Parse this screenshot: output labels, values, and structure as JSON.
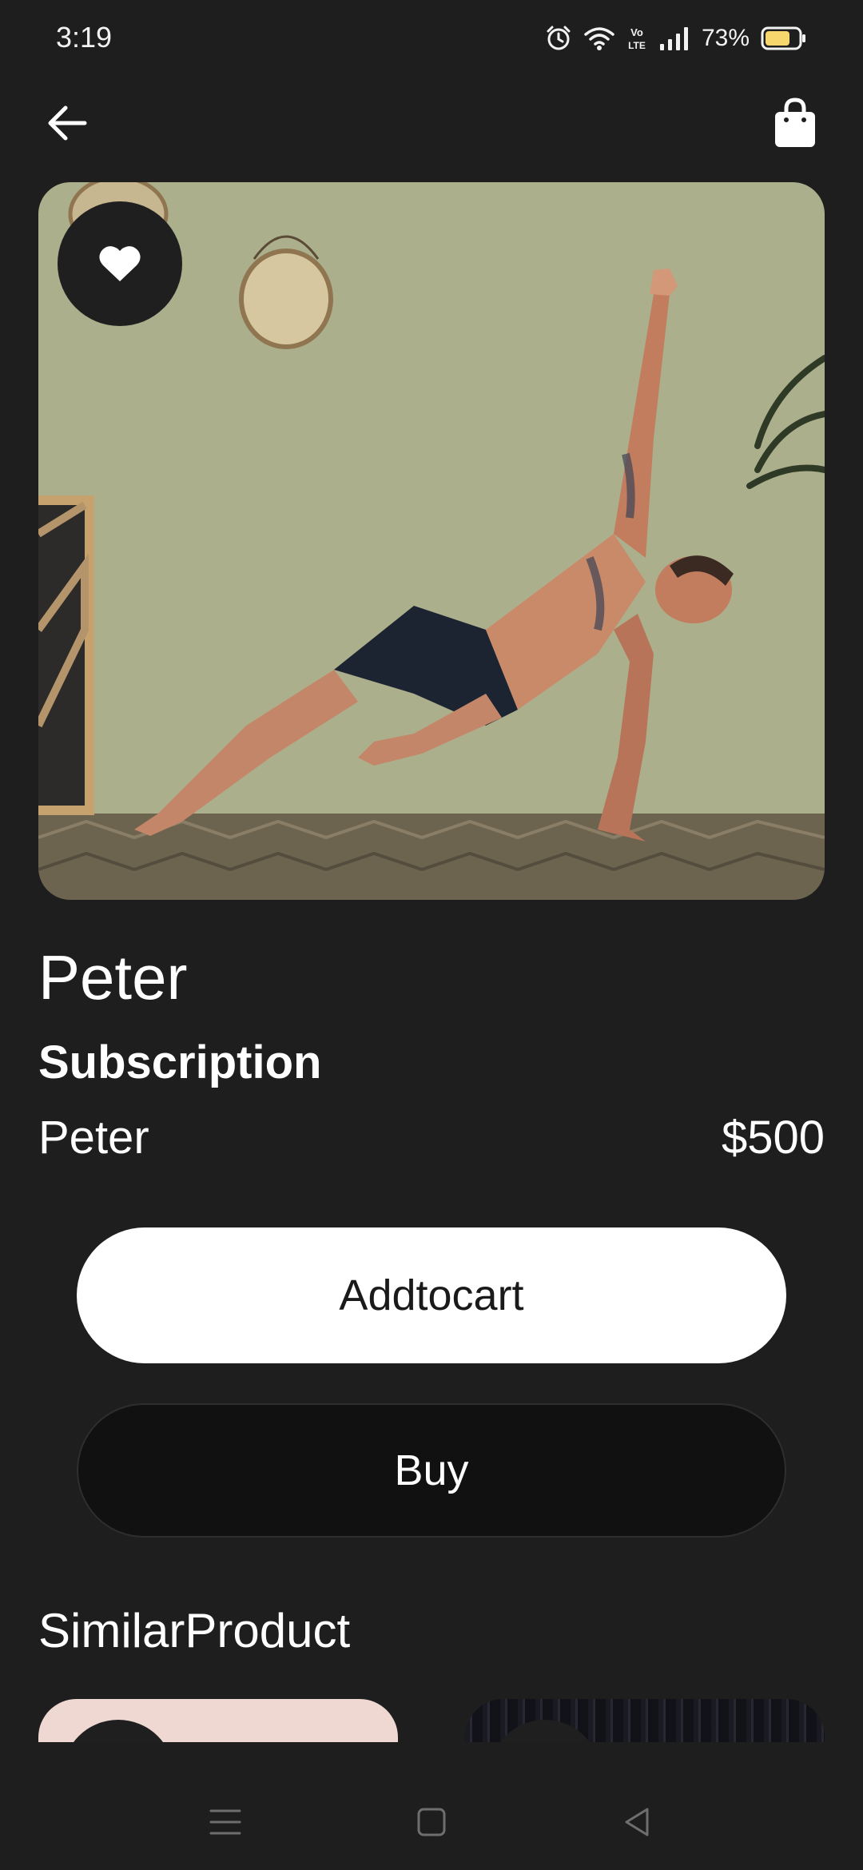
{
  "status_bar": {
    "time": "3:19",
    "battery": "73%",
    "icons": [
      "alarm-icon",
      "wifi-icon",
      "volte-icon",
      "signal-icon",
      "battery-icon"
    ],
    "volte_line1": "Vo",
    "volte_line2": "LTE"
  },
  "top_bar": {
    "back_icon": "arrow-left-icon",
    "cart_icon": "shopping-bag-icon"
  },
  "hero": {
    "image": "man-doing-yoga-side-plank",
    "favorite_icon": "heart-icon"
  },
  "product": {
    "title": "Peter",
    "category": "Subscription",
    "name": "Peter",
    "price": "$500"
  },
  "actions": {
    "add_to_cart_label": "Addtocart",
    "buy_label": "Buy"
  },
  "similar": {
    "title": "SimilarProduct",
    "items": [
      "pastel-product-image",
      "dark-product-image"
    ]
  },
  "nav_bar": {
    "icons": [
      "menu-icon",
      "home-square-icon",
      "back-triangle-icon"
    ]
  },
  "colors": {
    "background": "#1e1e1f",
    "primary_button": "#ffffff",
    "secondary_button": "#111111",
    "battery_fill": "#f5d76e"
  }
}
